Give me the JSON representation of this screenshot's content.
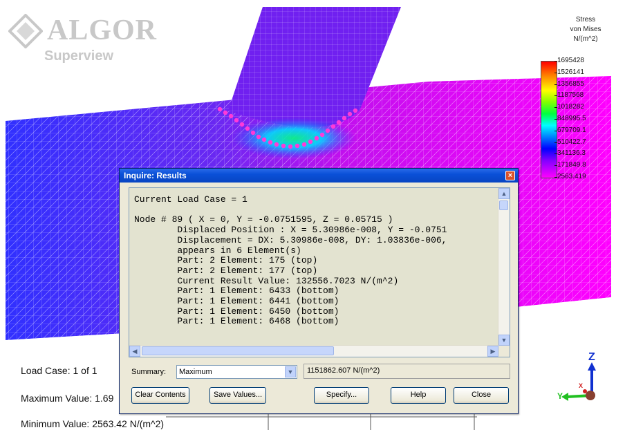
{
  "logo": {
    "brand": "ALGOR",
    "product": "Superview"
  },
  "legend": {
    "title_lines": [
      "Stress",
      "von Mises",
      "N/(m^2)"
    ],
    "values": [
      "1695428",
      "1526141",
      "1356855",
      "1187568",
      "1018282",
      "848995.5",
      "679709.1",
      "510422.7",
      "341136.3",
      "171849.8",
      "2563.419"
    ]
  },
  "info": {
    "load_case": "Load Case:  1 of 1",
    "max_value": "Maximum Value: 1.69",
    "min_value": "Minimum Value: 2563.42 N/(m^2)"
  },
  "axis": {
    "z": "Z",
    "y": "Y",
    "x": "X"
  },
  "dialog": {
    "title": "Inquire: Results",
    "close_glyph": "×",
    "text_lines": [
      "Current Load Case = 1",
      "",
      "Node # 89 ( X = 0, Y = -0.0751595, Z = 0.05715 )",
      "        Displaced Position : X = 5.30986e-008, Y = -0.0751",
      "        Displacement = DX: 5.30986e-008, DY: 1.03836e-006,",
      "        appears in 6 Element(s)",
      "        Part: 2 Element: 175 (top)",
      "        Part: 2 Element: 177 (top)",
      "        Current Result Value: 132556.7023 N/(m^2)",
      "        Part: 1 Element: 6433 (bottom)",
      "        Part: 1 Element: 6441 (bottom)",
      "        Part: 1 Element: 6450 (bottom)",
      "        Part: 1 Element: 6468 (bottom)"
    ],
    "summary_label": "Summary:",
    "summary_selected": "Maximum",
    "summary_value": "1151862.607 N/(m^2)",
    "buttons": {
      "clear": "Clear Contents",
      "save": "Save Values...",
      "specify": "Specify...",
      "help": "Help",
      "close": "Close"
    }
  }
}
